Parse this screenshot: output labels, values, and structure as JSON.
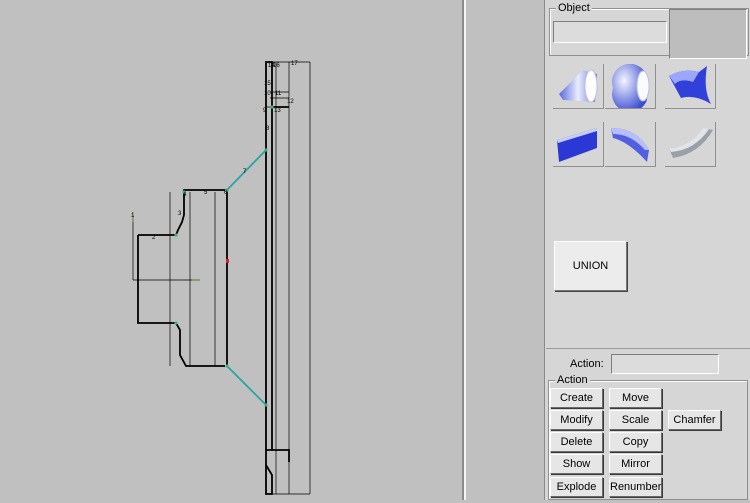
{
  "object_group": {
    "title": "Object"
  },
  "tools": [
    {
      "name": "cone-shape-icon"
    },
    {
      "name": "sphere-shape-icon"
    },
    {
      "name": "curved-wedge-icon"
    },
    {
      "name": "flat-slab-icon"
    },
    {
      "name": "curved-blade-icon"
    },
    {
      "name": "bent-plate-icon"
    }
  ],
  "union_button": "UNION",
  "action_field_label": "Action:",
  "action_group": {
    "title": "Action"
  },
  "buttons": {
    "create": "Create",
    "move": "Move",
    "modify": "Modify",
    "scale": "Scale",
    "chamfer": "Chamfer",
    "delete": "Delete",
    "copy": "Copy",
    "show": "Show",
    "mirror": "Mirror",
    "explode": "Explode",
    "renumber": "Renumber"
  },
  "sketch_labels": [
    "1",
    "2",
    "3",
    "4",
    "5",
    "6",
    "7",
    "8",
    "9",
    "10",
    "11",
    "12",
    "13",
    "14",
    "15",
    "16",
    "17"
  ],
  "colors": {
    "profile": "#000000",
    "taper": "#2aa3a3",
    "node": "#3cb371",
    "axis_marker": "#e02020",
    "tool_blue": "#3040d8"
  }
}
